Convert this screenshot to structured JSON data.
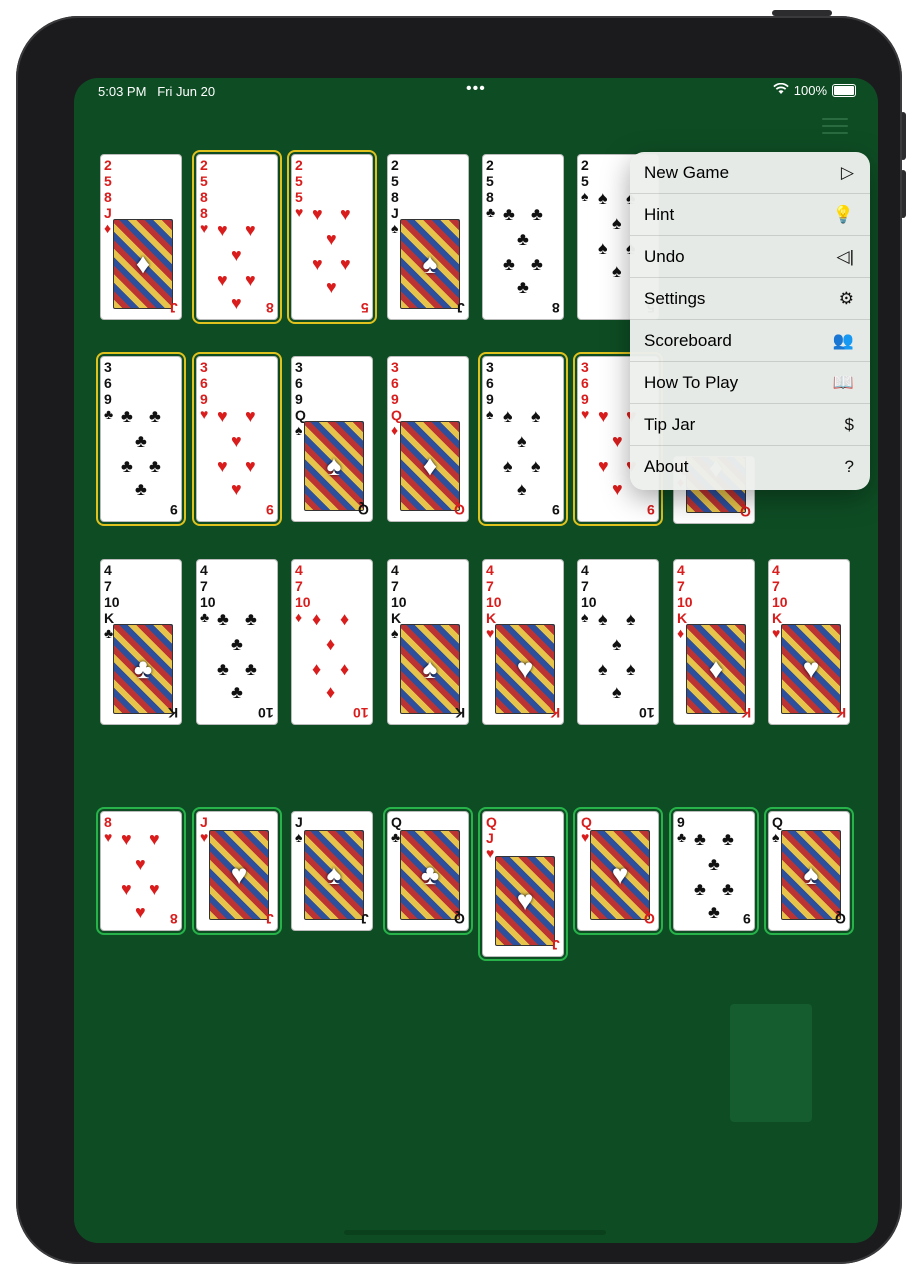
{
  "status": {
    "time": "5:03 PM",
    "date": "Fri Jun 20",
    "battery": "100%"
  },
  "menu": {
    "items": [
      {
        "label": "New Game",
        "icon": "play-icon",
        "glyph": "▷"
      },
      {
        "label": "Hint",
        "icon": "lightbulb-icon",
        "glyph": "💡"
      },
      {
        "label": "Undo",
        "icon": "undo-icon",
        "glyph": "◁|"
      },
      {
        "label": "Settings",
        "icon": "gear-icon",
        "glyph": "⚙"
      },
      {
        "label": "Scoreboard",
        "icon": "people-icon",
        "glyph": "👥"
      },
      {
        "label": "How To Play",
        "icon": "book-icon",
        "glyph": "📖"
      },
      {
        "label": "Tip Jar",
        "icon": "dollar-icon",
        "glyph": "$"
      },
      {
        "label": "About",
        "icon": "question-icon",
        "glyph": "?"
      }
    ]
  },
  "colors": {
    "felt": "#0e4d24",
    "select_yellow": "#e0c21e",
    "select_green": "#27b34a"
  },
  "rows": [
    [
      {
        "ranks": [
          "2",
          "5",
          "8"
        ],
        "top": "J",
        "suit": "♦",
        "face": true
      },
      {
        "ranks": [
          "2",
          "5",
          "8"
        ],
        "top": "8",
        "suit": "♥",
        "face": false
      },
      {
        "ranks": [
          "2",
          "5"
        ],
        "top": "5",
        "suit": "♥",
        "face": false
      },
      {
        "ranks": [
          "2",
          "5",
          "8"
        ],
        "top": "J",
        "suit": "♠",
        "face": true
      },
      {
        "ranks": [
          "2",
          "5"
        ],
        "top": "8",
        "suit": "♣",
        "face": false
      },
      {
        "ranks": [
          "2"
        ],
        "top": "5",
        "suit": "♠",
        "face": false
      }
    ],
    [
      {
        "ranks": [
          "3",
          "6"
        ],
        "top": "9",
        "suit": "♣",
        "face": false
      },
      {
        "ranks": [
          "3",
          "6"
        ],
        "top": "9",
        "suit": "♥",
        "face": false
      },
      {
        "ranks": [
          "3",
          "6",
          "9"
        ],
        "top": "Q",
        "suit": "♠",
        "face": true
      },
      {
        "ranks": [
          "3",
          "6",
          "9"
        ],
        "top": "Q",
        "suit": "♦",
        "face": true
      },
      {
        "ranks": [
          "3",
          "6"
        ],
        "top": "9",
        "suit": "♠",
        "face": false
      },
      {
        "ranks": [
          "3",
          "6"
        ],
        "top": "9",
        "suit": "♥",
        "face": false
      },
      {
        "ranks": [],
        "top": "Q",
        "suit": "♦",
        "face": true
      }
    ],
    [
      {
        "ranks": [
          "4",
          "7",
          "10"
        ],
        "top": "K",
        "suit": "♣",
        "face": true
      },
      {
        "ranks": [
          "4",
          "7"
        ],
        "top": "10",
        "suit": "♣",
        "face": false
      },
      {
        "ranks": [
          "4",
          "7"
        ],
        "top": "10",
        "suit": "♦",
        "face": false
      },
      {
        "ranks": [
          "4",
          "7",
          "10"
        ],
        "top": "K",
        "suit": "♠",
        "face": true
      },
      {
        "ranks": [
          "4",
          "7",
          "10"
        ],
        "top": "K",
        "suit": "♥",
        "face": true
      },
      {
        "ranks": [
          "4",
          "7"
        ],
        "top": "10",
        "suit": "♠",
        "face": false
      },
      {
        "ranks": [
          "4",
          "7",
          "10"
        ],
        "top": "K",
        "suit": "♦",
        "face": true
      },
      {
        "ranks": [
          "4",
          "7",
          "10"
        ],
        "top": "K",
        "suit": "♥",
        "face": true
      }
    ],
    [
      {
        "ranks": [],
        "top": "8",
        "suit": "♥",
        "face": false
      },
      {
        "ranks": [],
        "top": "J",
        "suit": "♥",
        "face": true
      },
      {
        "ranks": [],
        "top": "J",
        "suit": "♠",
        "face": true
      },
      {
        "ranks": [],
        "top": "Q",
        "suit": "♣",
        "face": true
      },
      {
        "ranks": [
          "Q"
        ],
        "top": "J",
        "suit": "♥",
        "face": true
      },
      {
        "ranks": [],
        "top": "Q",
        "suit": "♥",
        "face": true
      },
      {
        "ranks": [],
        "top": "9",
        "suit": "♣",
        "face": false
      },
      {
        "ranks": [],
        "top": "Q",
        "suit": "♠",
        "face": true
      }
    ]
  ]
}
